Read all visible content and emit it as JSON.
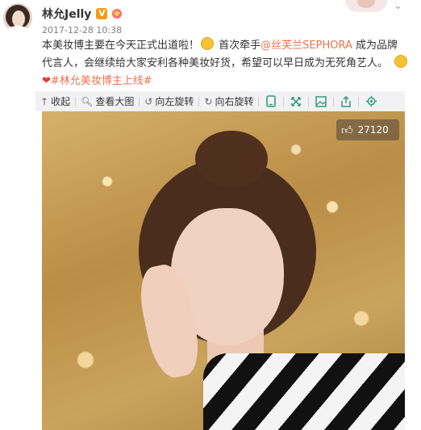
{
  "header": {
    "username": "林允Jelly",
    "verified_badge": "V",
    "timestamp": "2017-12-28 10:38"
  },
  "post": {
    "line1": "本美妆博主要在今天正式出道啦！",
    "line1_after_emoji": "首次牵手",
    "mention": "@丝芙兰SEPHORA",
    "line1_tail": "成为品牌",
    "line2": "代言人，会继续给大家安利各种美妆好货，希望可以早日成为无死角艺人。",
    "hashtag": "#林允美妆博主上线#"
  },
  "toolbar": {
    "collapse_label": "收起",
    "view_large_label": "查看大图",
    "rotate_left_label": "向左旋转",
    "rotate_right_label": "向右旋转",
    "collapse_icon": "up-arrow-icon",
    "view_large_icon": "magnifier-icon",
    "rotate_left_icon": "rotate-left-icon",
    "rotate_right_icon": "rotate-right-icon"
  },
  "photo": {
    "like_count": "27120"
  },
  "colors": {
    "link": "#eb7350",
    "toolbar_icon": "#2e9b78",
    "verified": "#f39c12"
  }
}
